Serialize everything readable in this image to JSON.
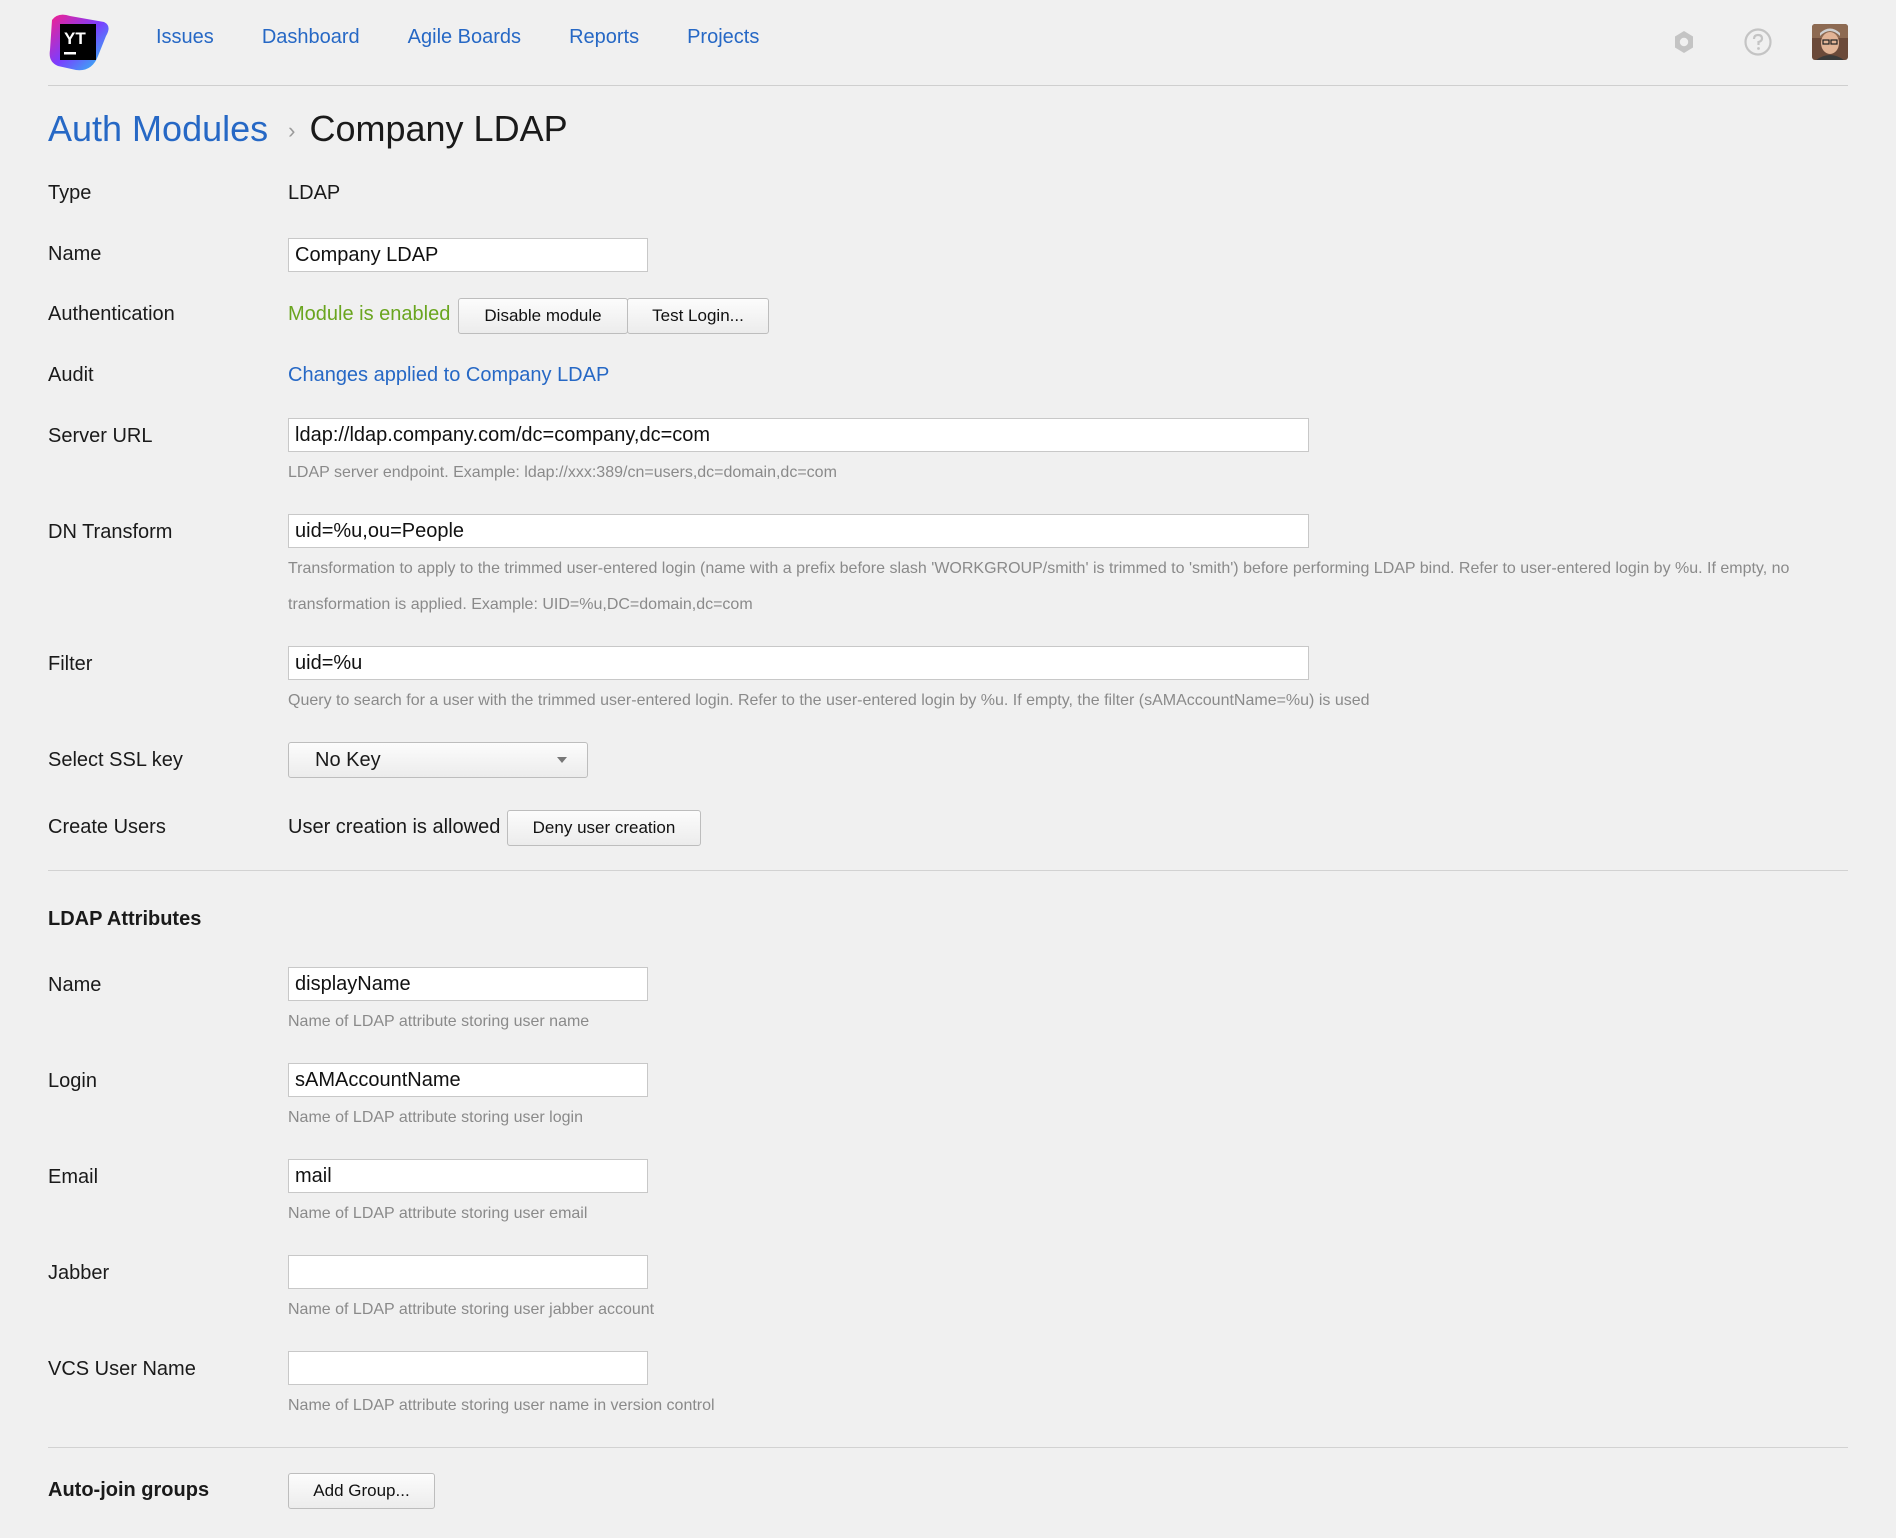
{
  "nav": {
    "logo_text": "YT",
    "items": [
      "Issues",
      "Dashboard",
      "Agile Boards",
      "Reports",
      "Projects"
    ]
  },
  "breadcrumb": {
    "parent": "Auth Modules",
    "separator": "›",
    "current": "Company LDAP"
  },
  "form": {
    "type": {
      "label": "Type",
      "value": "LDAP"
    },
    "name": {
      "label": "Name",
      "value": "Company LDAP"
    },
    "auth": {
      "label": "Authentication",
      "status": "Module is enabled",
      "disable_btn": "Disable module",
      "test_btn": "Test Login..."
    },
    "audit": {
      "label": "Audit",
      "link": "Changes applied to Company LDAP"
    },
    "server_url": {
      "label": "Server URL",
      "value": "ldap://ldap.company.com/dc=company,dc=com",
      "hint": "LDAP server endpoint. Example: ldap://xxx:389/cn=users,dc=domain,dc=com"
    },
    "dn_transform": {
      "label": "DN Transform",
      "value": "uid=%u,ou=People",
      "hint_line1": "Transformation to apply to the trimmed user-entered login (name with a prefix before slash 'WORKGROUP/smith' is trimmed to 'smith') before performing LDAP bind. Refer to user-entered login by %u. If empty, no",
      "hint_line2": "transformation is applied. Example: UID=%u,DC=domain,dc=com"
    },
    "filter": {
      "label": "Filter",
      "value": "uid=%u",
      "hint": "Query to search for a user with the trimmed user-entered login. Refer to the user-entered login by %u. If empty, the filter (sAMAccountName=%u) is used"
    },
    "ssl": {
      "label": "Select SSL key",
      "value": "No Key"
    },
    "create_users": {
      "label": "Create Users",
      "status": "User creation is allowed",
      "button": "Deny user creation"
    }
  },
  "ldap_attributes": {
    "title": "LDAP Attributes",
    "name": {
      "label": "Name",
      "value": "displayName",
      "hint": "Name of LDAP attribute storing user name"
    },
    "login": {
      "label": "Login",
      "value": "sAMAccountName",
      "hint": "Name of LDAP attribute storing user login"
    },
    "email": {
      "label": "Email",
      "value": "mail",
      "hint": "Name of LDAP attribute storing user email"
    },
    "jabber": {
      "label": "Jabber",
      "value": "",
      "hint": "Name of LDAP attribute storing user jabber account"
    },
    "vcs": {
      "label": "VCS User Name",
      "value": "",
      "hint": "Name of LDAP attribute storing user name in version control"
    }
  },
  "auto_join": {
    "title": "Auto-join groups",
    "button": "Add Group..."
  },
  "colors": {
    "link": "#2668c5",
    "enabled": "#6aa51f",
    "hint": "#8a8a8a",
    "background": "#f0f0f0"
  }
}
